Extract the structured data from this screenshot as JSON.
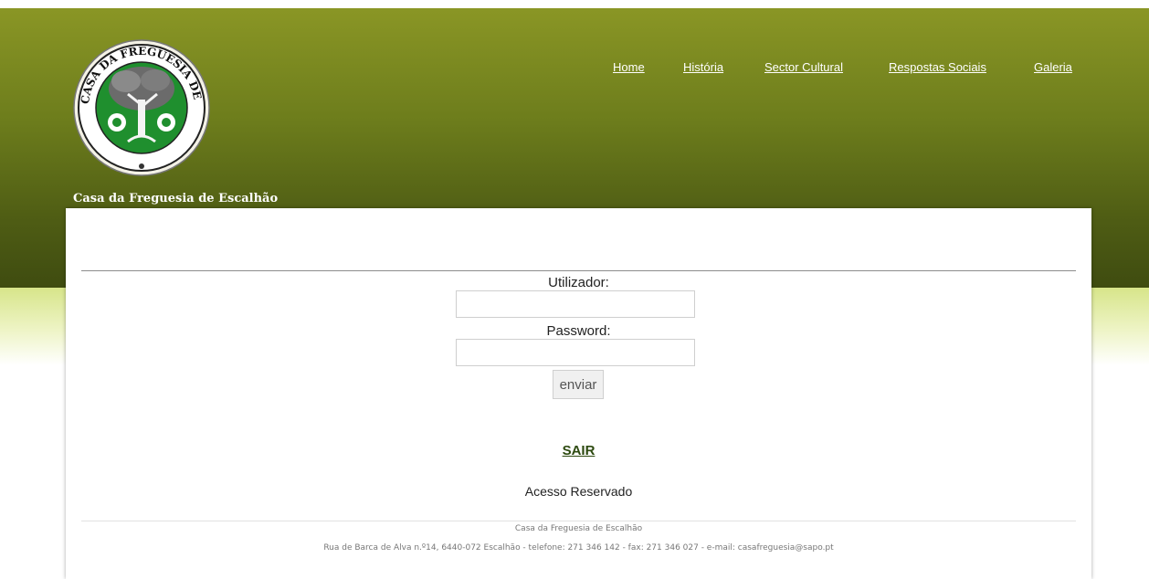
{
  "site": {
    "title": "Casa da Freguesia de Escalhão",
    "logo_ring_text": "CASA DA FREGUESIA DE ESCALHÃO"
  },
  "nav": {
    "items": [
      {
        "label": "Home"
      },
      {
        "label": "História"
      },
      {
        "label": "Sector Cultural"
      },
      {
        "label": "Respostas Sociais"
      },
      {
        "label": "Galeria"
      }
    ]
  },
  "login": {
    "username_label": "Utilizador:",
    "username_value": "",
    "password_label": "Password:",
    "password_value": "",
    "submit_label": "enviar"
  },
  "logout_label": "SAIR",
  "restricted_note": "Acesso Reservado",
  "footer": {
    "name": "Casa da Freguesia de Escalhão",
    "address": "Rua de Barca de Alva n.º14, 6440-072 Escalhão - telefone: 271 346 142 - fax: 271 346 027 - e-mail: casafreguesia@sapo.pt"
  },
  "colors": {
    "header_top": "#8a9625",
    "header_bottom": "#3f4c10",
    "band_light": "#d7e58a",
    "logo_green": "#1f8f2e",
    "logout_link": "#2d4a10"
  }
}
